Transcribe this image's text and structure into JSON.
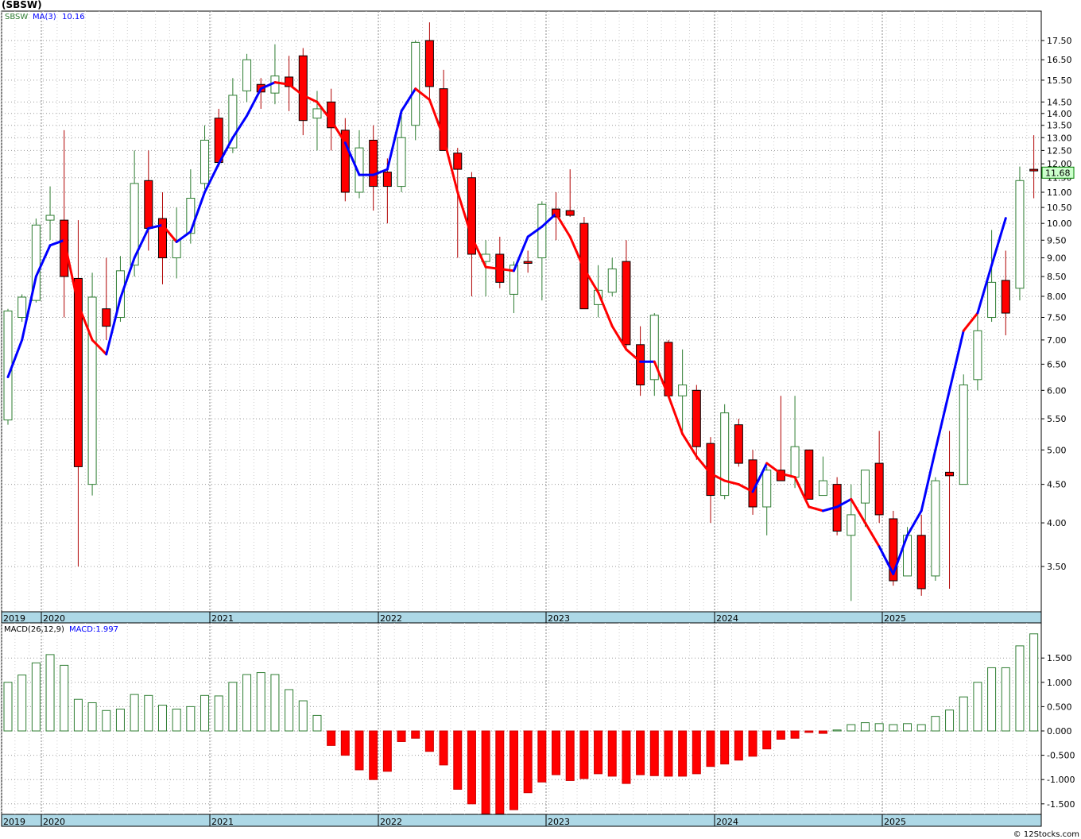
{
  "header": {
    "symbol_label": "(SBSW)"
  },
  "watermark": "© 12Stocks.com",
  "colors": {
    "up_candle": "#2e7d32",
    "down_candle": "#ff0000",
    "ma_up": "#0000ff",
    "ma_down": "#ff0000",
    "hist_pos": "#2e7d32",
    "hist_neg": "#ff0000",
    "grid": "#999999",
    "axis_strip": "#add8e6",
    "last_price_bg": "#ccffcc",
    "last_price_fg": "#006400"
  },
  "chart_data": [
    {
      "type": "candlestick",
      "panel": "price",
      "series_label": "SBSW",
      "indicator_label": "MA(3)",
      "indicator_value": "10.16",
      "last_price_label": "11.68",
      "yscale": "log",
      "ylim": [
        3.2,
        18.5
      ],
      "ytick_labels": [
        "3.50",
        "4.00",
        "4.50",
        "5.00",
        "5.50",
        "6.00",
        "6.50",
        "7.00",
        "7.50",
        "8.00",
        "8.50",
        "9.00",
        "9.50",
        "10.00",
        "10.50",
        "11.00",
        "11.50",
        "12.00",
        "12.50",
        "13.00",
        "13.50",
        "14.00",
        "14.50",
        "15.50",
        "16.50",
        "17.50"
      ],
      "xtick_labels": [
        "2019",
        "2020",
        "2021",
        "2022",
        "2023",
        "2024",
        "2025"
      ],
      "x_range": [
        "2019-12",
        "2025-11"
      ],
      "grid": true,
      "candles": [
        {
          "date": "2019-12",
          "o": 5.48,
          "h": 7.7,
          "l": 5.4,
          "c": 7.65
        },
        {
          "date": "2020-01",
          "o": 7.5,
          "h": 8.05,
          "l": 7.4,
          "c": 7.98
        },
        {
          "date": "2020-02",
          "o": 7.9,
          "h": 10.15,
          "l": 7.85,
          "c": 9.95
        },
        {
          "date": "2020-03",
          "o": 10.1,
          "h": 11.2,
          "l": 9.5,
          "c": 10.25
        },
        {
          "date": "2020-04",
          "o": 10.1,
          "h": 13.3,
          "l": 7.5,
          "c": 8.5
        },
        {
          "date": "2020-05",
          "o": 8.45,
          "h": 10.1,
          "l": 3.5,
          "c": 4.75
        },
        {
          "date": "2020-06",
          "o": 4.5,
          "h": 8.6,
          "l": 4.35,
          "c": 7.98
        },
        {
          "date": "2020-07",
          "o": 7.7,
          "h": 9.0,
          "l": 7.0,
          "c": 7.3
        },
        {
          "date": "2020-08",
          "o": 7.5,
          "h": 9.05,
          "l": 7.4,
          "c": 8.65
        },
        {
          "date": "2020-09",
          "o": 8.8,
          "h": 12.5,
          "l": 8.5,
          "c": 11.3
        },
        {
          "date": "2020-10",
          "o": 11.4,
          "h": 12.5,
          "l": 9.2,
          "c": 9.85
        },
        {
          "date": "2020-11",
          "o": 10.15,
          "h": 11.0,
          "l": 8.3,
          "c": 9.0
        },
        {
          "date": "2020-12",
          "o": 9.0,
          "h": 10.5,
          "l": 8.45,
          "c": 9.5
        },
        {
          "date": "2021-01",
          "o": 9.7,
          "h": 11.8,
          "l": 9.4,
          "c": 10.8
        },
        {
          "date": "2021-02",
          "o": 11.3,
          "h": 13.5,
          "l": 11.1,
          "c": 12.9
        },
        {
          "date": "2021-03",
          "o": 13.8,
          "h": 14.2,
          "l": 11.9,
          "c": 12.05
        },
        {
          "date": "2021-04",
          "o": 12.6,
          "h": 15.6,
          "l": 12.4,
          "c": 14.8
        },
        {
          "date": "2021-05",
          "o": 15.0,
          "h": 16.8,
          "l": 14.5,
          "c": 16.5
        },
        {
          "date": "2021-06",
          "o": 15.3,
          "h": 15.6,
          "l": 14.2,
          "c": 14.95
        },
        {
          "date": "2021-07",
          "o": 14.9,
          "h": 17.3,
          "l": 14.4,
          "c": 15.7
        },
        {
          "date": "2021-08",
          "o": 15.65,
          "h": 16.7,
          "l": 14.1,
          "c": 15.2
        },
        {
          "date": "2021-09",
          "o": 16.7,
          "h": 17.1,
          "l": 13.1,
          "c": 13.7
        },
        {
          "date": "2021-10",
          "o": 13.8,
          "h": 15.0,
          "l": 12.5,
          "c": 14.2
        },
        {
          "date": "2021-11",
          "o": 14.5,
          "h": 15.1,
          "l": 12.5,
          "c": 13.4
        },
        {
          "date": "2021-12",
          "o": 13.3,
          "h": 13.8,
          "l": 10.7,
          "c": 11.0
        },
        {
          "date": "2022-01",
          "o": 11.0,
          "h": 13.3,
          "l": 10.8,
          "c": 12.6
        },
        {
          "date": "2022-02",
          "o": 12.9,
          "h": 13.5,
          "l": 10.4,
          "c": 11.2
        },
        {
          "date": "2022-03",
          "o": 11.7,
          "h": 12.2,
          "l": 10.0,
          "c": 11.2
        },
        {
          "date": "2022-04",
          "o": 11.2,
          "h": 14.2,
          "l": 11.0,
          "c": 13.0
        },
        {
          "date": "2022-05",
          "o": 13.5,
          "h": 17.5,
          "l": 12.9,
          "c": 17.4
        },
        {
          "date": "2022-06",
          "o": 17.5,
          "h": 18.5,
          "l": 14.5,
          "c": 15.2
        },
        {
          "date": "2022-07",
          "o": 15.1,
          "h": 16.0,
          "l": 12.5,
          "c": 12.5
        },
        {
          "date": "2022-08",
          "o": 12.4,
          "h": 12.6,
          "l": 9.0,
          "c": 11.8
        },
        {
          "date": "2022-09",
          "o": 11.5,
          "h": 11.7,
          "l": 8.0,
          "c": 9.1
        },
        {
          "date": "2022-10",
          "o": 8.9,
          "h": 9.5,
          "l": 8.0,
          "c": 9.1
        },
        {
          "date": "2022-11",
          "o": 9.1,
          "h": 9.6,
          "l": 8.2,
          "c": 8.35
        },
        {
          "date": "2022-12",
          "o": 8.05,
          "h": 8.9,
          "l": 7.6,
          "c": 8.8
        },
        {
          "date": "2023-01",
          "o": 8.9,
          "h": 9.2,
          "l": 8.6,
          "c": 8.85
        },
        {
          "date": "2023-02",
          "o": 9.0,
          "h": 10.7,
          "l": 7.9,
          "c": 10.6
        },
        {
          "date": "2023-03",
          "o": 10.45,
          "h": 11.0,
          "l": 9.5,
          "c": 10.2
        },
        {
          "date": "2023-04",
          "o": 10.4,
          "h": 11.8,
          "l": 10.2,
          "c": 10.25
        },
        {
          "date": "2023-05",
          "o": 10.0,
          "h": 10.2,
          "l": 7.7,
          "c": 7.7
        },
        {
          "date": "2023-06",
          "o": 7.8,
          "h": 8.8,
          "l": 7.5,
          "c": 8.15
        },
        {
          "date": "2023-07",
          "o": 8.1,
          "h": 9.0,
          "l": 8.0,
          "c": 8.7
        },
        {
          "date": "2023-08",
          "o": 8.9,
          "h": 9.5,
          "l": 6.8,
          "c": 6.9
        },
        {
          "date": "2023-09",
          "o": 6.9,
          "h": 7.3,
          "l": 5.9,
          "c": 6.1
        },
        {
          "date": "2023-10",
          "o": 6.2,
          "h": 7.6,
          "l": 5.9,
          "c": 7.55
        },
        {
          "date": "2023-11",
          "o": 6.95,
          "h": 7.0,
          "l": 5.9,
          "c": 5.9
        },
        {
          "date": "2023-12",
          "o": 5.9,
          "h": 6.8,
          "l": 5.3,
          "c": 6.1
        },
        {
          "date": "2024-01",
          "o": 6.0,
          "h": 6.1,
          "l": 4.85,
          "c": 5.05
        },
        {
          "date": "2024-02",
          "o": 5.1,
          "h": 5.2,
          "l": 4.0,
          "c": 4.35
        },
        {
          "date": "2024-03",
          "o": 4.35,
          "h": 5.75,
          "l": 4.3,
          "c": 5.6
        },
        {
          "date": "2024-04",
          "o": 5.4,
          "h": 5.5,
          "l": 4.75,
          "c": 4.8
        },
        {
          "date": "2024-05",
          "o": 4.85,
          "h": 5.0,
          "l": 4.1,
          "c": 4.2
        },
        {
          "date": "2024-06",
          "o": 4.2,
          "h": 4.75,
          "l": 3.85,
          "c": 4.7
        },
        {
          "date": "2024-07",
          "o": 4.7,
          "h": 5.9,
          "l": 4.55,
          "c": 4.55
        },
        {
          "date": "2024-08",
          "o": 4.6,
          "h": 5.9,
          "l": 4.45,
          "c": 5.05
        },
        {
          "date": "2024-09",
          "o": 5.0,
          "h": 5.0,
          "l": 4.3,
          "c": 4.3
        },
        {
          "date": "2024-10",
          "o": 4.35,
          "h": 4.9,
          "l": 4.35,
          "c": 4.55
        },
        {
          "date": "2024-11",
          "o": 4.5,
          "h": 4.6,
          "l": 3.85,
          "c": 3.9
        },
        {
          "date": "2024-12",
          "o": 3.85,
          "h": 4.5,
          "l": 3.15,
          "c": 4.1
        },
        {
          "date": "2025-01",
          "o": 4.25,
          "h": 4.7,
          "l": 3.95,
          "c": 4.7
        },
        {
          "date": "2025-02",
          "o": 4.8,
          "h": 5.3,
          "l": 4.0,
          "c": 4.1
        },
        {
          "date": "2025-03",
          "o": 4.05,
          "h": 4.15,
          "l": 3.3,
          "c": 3.35
        },
        {
          "date": "2025-04",
          "o": 3.4,
          "h": 3.95,
          "l": 3.4,
          "c": 3.85
        },
        {
          "date": "2025-05",
          "o": 3.85,
          "h": 4.1,
          "l": 3.2,
          "c": 3.27
        },
        {
          "date": "2025-06",
          "o": 3.4,
          "h": 4.6,
          "l": 3.35,
          "c": 4.55
        },
        {
          "date": "2025-07",
          "o": 4.67,
          "h": 5.3,
          "l": 3.27,
          "c": 4.62
        },
        {
          "date": "2025-08",
          "o": 4.5,
          "h": 6.3,
          "l": 4.5,
          "c": 6.1
        },
        {
          "date": "2025-09",
          "o": 6.2,
          "h": 7.55,
          "l": 6.0,
          "c": 7.2
        },
        {
          "date": "2025-10",
          "o": 7.5,
          "h": 9.8,
          "l": 7.4,
          "c": 8.35
        },
        {
          "date": "2025-11",
          "o": 8.4,
          "h": 9.2,
          "l": 7.1,
          "c": 7.6
        },
        {
          "date": "2025-12",
          "o": 8.2,
          "h": 11.9,
          "l": 7.9,
          "c": 11.4
        },
        {
          "date": "2026-01",
          "o": 11.8,
          "h": 13.1,
          "l": 10.8,
          "c": 11.75
        }
      ],
      "ma3": [
        6.25,
        7.0,
        8.5,
        9.35,
        9.5,
        7.8,
        7.0,
        6.7,
        7.95,
        9.0,
        9.85,
        9.95,
        9.45,
        9.75,
        11.0,
        12.0,
        13.0,
        13.9,
        15.1,
        15.4,
        15.3,
        14.8,
        14.5,
        13.7,
        12.8,
        11.6,
        11.6,
        11.8,
        14.1,
        15.1,
        14.6,
        13.0,
        11.0,
        9.6,
        8.75,
        8.7,
        8.65,
        9.6,
        9.9,
        10.3,
        9.6,
        8.7,
        8.1,
        7.3,
        6.8,
        6.55,
        6.55,
        5.9,
        5.25,
        4.9,
        4.65,
        4.55,
        4.5,
        4.4,
        4.8,
        4.65,
        4.6,
        4.2,
        4.15,
        4.2,
        4.3,
        4.0,
        3.72,
        3.42,
        3.85,
        4.15,
        5.0,
        6.0,
        7.2,
        7.6,
        8.8,
        10.16
      ],
      "ma3_dir": [
        "u",
        "u",
        "u",
        "u",
        "u",
        "d",
        "d",
        "d",
        "u",
        "u",
        "u",
        "u",
        "d",
        "u",
        "u",
        "u",
        "u",
        "u",
        "u",
        "u",
        "d",
        "d",
        "d",
        "d",
        "d",
        "u",
        "u",
        "u",
        "u",
        "u",
        "d",
        "d",
        "d",
        "d",
        "d",
        "d",
        "d",
        "u",
        "u",
        "u",
        "d",
        "d",
        "d",
        "d",
        "d",
        "d",
        "u",
        "d",
        "d",
        "d",
        "d",
        "d",
        "d",
        "d",
        "u",
        "d",
        "d",
        "d",
        "d",
        "u",
        "u",
        "d",
        "d",
        "u",
        "u",
        "u",
        "u",
        "u",
        "u",
        "d",
        "u",
        "u"
      ]
    },
    {
      "type": "bar",
      "panel": "macd",
      "series_label": "MACD(26,12,9)",
      "value_label": "MACD:1.997",
      "ylim": [
        -1.72,
        2.0
      ],
      "ytick_labels": [
        "1.500",
        "1.000",
        "0.500",
        "0.000",
        "-0.500",
        "-1.000",
        "-1.500"
      ],
      "ytick_values": [
        1.5,
        1.0,
        0.5,
        0.0,
        -0.5,
        -1.0,
        -1.5
      ],
      "xtick_labels": [
        "2019",
        "2020",
        "2021",
        "2022",
        "2023",
        "2024",
        "2025"
      ],
      "values": [
        1.0,
        1.15,
        1.4,
        1.57,
        1.35,
        0.65,
        0.58,
        0.42,
        0.45,
        0.75,
        0.73,
        0.53,
        0.45,
        0.5,
        0.73,
        0.72,
        1.0,
        1.16,
        1.2,
        1.16,
        0.85,
        0.62,
        0.32,
        -0.3,
        -0.5,
        -0.8,
        -1.0,
        -0.83,
        -0.22,
        -0.15,
        -0.42,
        -0.7,
        -1.2,
        -1.5,
        -1.7,
        -1.7,
        -1.62,
        -1.27,
        -1.05,
        -0.9,
        -1.02,
        -0.98,
        -0.88,
        -0.93,
        -1.08,
        -0.9,
        -0.92,
        -0.93,
        -0.93,
        -0.88,
        -0.73,
        -0.68,
        -0.6,
        -0.52,
        -0.37,
        -0.17,
        -0.15,
        -0.03,
        -0.05,
        0.02,
        0.13,
        0.17,
        0.15,
        0.13,
        0.15,
        0.13,
        0.3,
        0.43,
        0.7,
        1.0,
        1.3,
        1.3,
        1.75,
        1.997
      ]
    }
  ]
}
